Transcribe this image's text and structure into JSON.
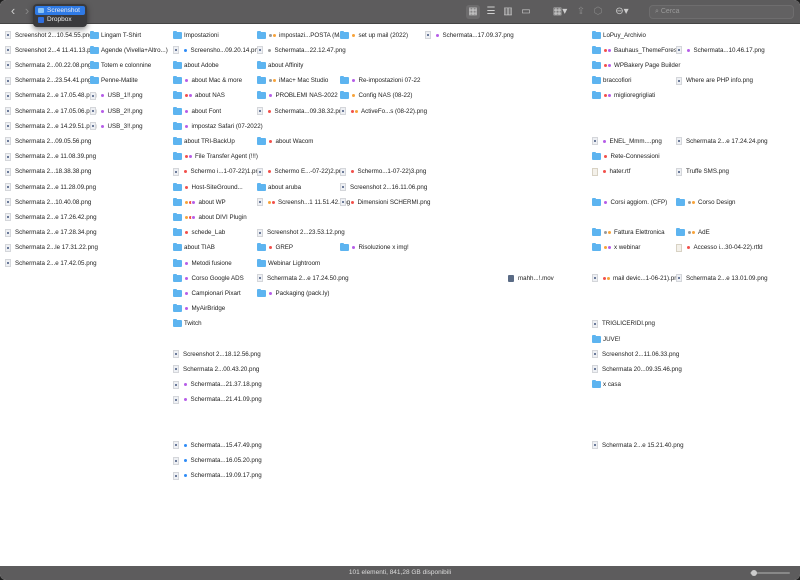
{
  "window": {
    "path_menu": [
      {
        "label": "Screenshot",
        "selected": true
      },
      {
        "label": "Dropbox",
        "selected": false
      }
    ]
  },
  "toolbar": {
    "back": "‹",
    "forward": "›",
    "view_icons": "▦",
    "view_list": "☰",
    "view_columns": "▥",
    "view_gallery": "▭",
    "group": "▦▾",
    "share": "⇪",
    "tag": "⬡",
    "action": "⊖▾",
    "search_placeholder": "Cerca",
    "search_icon": "⌕"
  },
  "tag_colors": {
    "p": "#b65de8",
    "r": "#f2504b",
    "o": "#f8a33a",
    "b": "#2f8cf7",
    "g": "#9a9a9a"
  },
  "columns": [
    [
      [
        "png",
        "",
        "Screenshot 2...10.54.55.png"
      ],
      [
        "png",
        "",
        "Screenshot 2...4 11.41.13.png"
      ],
      [
        "png",
        "",
        "Schermata 2...00.22.08.png"
      ],
      [
        "png",
        "",
        "Schermata 2...23.54.41.png"
      ],
      [
        "png",
        "",
        "Schermata 2...e 17.05.48.png"
      ],
      [
        "png",
        "",
        "Schermata 2...e 17.05.06.png"
      ],
      [
        "png",
        "",
        "Schermata 2...e 14.29.51.png"
      ],
      [
        "png",
        "",
        "Schermata 2...09.05.56.png"
      ],
      [
        "png",
        "",
        "Schermata 2...e 11.08.39.png"
      ],
      [
        "png",
        "",
        "Schermata 2...18.38.38.png"
      ],
      [
        "png",
        "",
        "Schermata 2...e 11.28.09.png"
      ],
      [
        "png",
        "",
        "Schermata 2...10.40.08.png"
      ],
      [
        "png",
        "",
        "Schermata 2...e 17.26.42.png"
      ],
      [
        "png",
        "",
        "Schermata 2...e 17.28.34.png"
      ],
      [
        "png",
        "",
        "Schermata 2...le 17.31.22.png"
      ],
      [
        "png",
        "",
        "Schermata 2...e 17.42.05.png"
      ]
    ],
    [
      [
        "folder",
        "",
        "Lingam T-Shirt"
      ],
      [
        "folder",
        "",
        "Agende (Vivella+Altro...)"
      ],
      [
        "folder",
        "",
        "Totem e colonnine"
      ],
      [
        "folder",
        "",
        "Penne-Matite"
      ],
      [
        "png",
        "p",
        "USB_1!!.png"
      ],
      [
        "png",
        "p",
        "USB_2!!.png"
      ],
      [
        "png",
        "p",
        "USB_3!!.png"
      ]
    ],
    [
      [
        "folder",
        "",
        "Impostazioni"
      ],
      [
        "png",
        "b",
        "Screensho...09.20.14.png"
      ],
      [
        "folder",
        "",
        "about Adobe"
      ],
      [
        "folder",
        "p",
        "about Mac & more"
      ],
      [
        "folder",
        "rp",
        "about NAS"
      ],
      [
        "folder",
        "p",
        "about Font"
      ],
      [
        "folder",
        "p",
        "impostaz Safari (07-2022)"
      ],
      [
        "folder",
        "",
        "about TRI-BackUp"
      ],
      [
        "folder",
        "rp",
        "File Transfer Agent (!!!)"
      ],
      [
        "png",
        "r",
        "Schermo i...1-07-22)1.png"
      ],
      [
        "folder",
        "r",
        "Host-SiteGround..."
      ],
      [
        "folder",
        "orp",
        "about WP"
      ],
      [
        "folder",
        "orp",
        "about DIVI Plugin"
      ],
      [
        "folder",
        "r",
        "schede_Lab"
      ],
      [
        "folder",
        "",
        "about TIAB"
      ],
      [
        "folder",
        "p",
        "Metodi fusione"
      ],
      [
        "folder",
        "p",
        "Corso Google ADS"
      ],
      [
        "folder",
        "p",
        "Campionari Pixart"
      ],
      [
        "folder",
        "p",
        "MyAirBridge"
      ],
      [
        "folder",
        "",
        "Twitch"
      ],
      null,
      [
        "png",
        "",
        "Screenshot 2...18.12.56.png"
      ],
      [
        "png",
        "",
        "Schermata 2...00.43.20.png"
      ],
      [
        "png",
        "p",
        "Schermata...21.37.18.png"
      ],
      [
        "png",
        "p",
        "Schermata...21.41.09.png"
      ],
      null,
      null,
      [
        "png",
        "b",
        "Schermata...15.47.49.png"
      ],
      [
        "png",
        "b",
        "Schermata...16.05.20.png"
      ],
      [
        "png",
        "b",
        "Schermata...19.09.17.png"
      ]
    ],
    [
      [
        "folder",
        "go",
        "impostazi...POSTA (Mail)"
      ],
      [
        "png",
        "g",
        "Schermata...22.12.47.png"
      ],
      [
        "folder",
        "",
        "about Affinity"
      ],
      [
        "folder",
        "go",
        "iMac+ Mac Studio"
      ],
      [
        "folder",
        "p",
        "PROBLEMI NAS-2022"
      ],
      [
        "png",
        "r",
        "Schermata...09.38.32.png"
      ],
      null,
      [
        "folder",
        "r",
        "about Wacom"
      ],
      null,
      [
        "png",
        "r",
        "Schermo E...-07-22)2.png"
      ],
      [
        "folder",
        "",
        "about aruba"
      ],
      [
        "png",
        "or",
        "Screensh...1 11.51.42.png"
      ],
      null,
      [
        "png",
        "",
        "Screenshot 2...23.53.12.png"
      ],
      [
        "folder",
        "r",
        "GREP"
      ],
      [
        "folder",
        "",
        "Webinar Lightroom"
      ],
      [
        "png",
        "",
        "Schermata 2...e 17.24.50.png"
      ],
      [
        "folder",
        "p",
        "Packaging (pack.ly)"
      ]
    ],
    [
      [
        "folder",
        "o",
        "set up mail (2022)"
      ],
      null,
      null,
      [
        "folder",
        "p",
        "Re-impostazioni 07-22"
      ],
      [
        "folder",
        "o",
        "Config NAS (08-22)"
      ],
      [
        "png",
        "ro",
        "ActiveFo...s (08-22).png"
      ],
      null,
      null,
      null,
      [
        "png",
        "r",
        "Schermo...1-07-22)3.png"
      ],
      [
        "png",
        "",
        "Screenshot 2...16.11.06.png"
      ],
      [
        "png",
        "r",
        "Dimensioni SCHERMI.png"
      ],
      null,
      null,
      [
        "folder",
        "p",
        "Risoluzione x img!"
      ]
    ],
    [
      [
        "png",
        "p",
        "Schermata...17.09.37.png"
      ]
    ],
    [
      null,
      null,
      null,
      null,
      null,
      null,
      null,
      null,
      null,
      null,
      null,
      null,
      null,
      null,
      null,
      null,
      [
        "mov",
        "",
        "mahh...!.mov"
      ]
    ],
    [
      [
        "folder",
        "",
        "LoPuy_Archivio"
      ],
      [
        "folder",
        "rp",
        "Bauhaus_ThemeForest"
      ],
      [
        "folder",
        "rp",
        "WPBakery Page Builder"
      ],
      [
        "folder",
        "",
        "braccofiori"
      ],
      [
        "folder",
        "rp",
        "miglioregrigliati"
      ],
      null,
      null,
      [
        "png",
        "p",
        "ENEL_Mmm....png"
      ],
      [
        "folder",
        "r",
        "Rete-Connessioni"
      ],
      [
        "rtf",
        "r",
        "hater.rtf"
      ],
      null,
      [
        "folder",
        "p",
        "Corsi aggiorn. (CFP)"
      ],
      null,
      [
        "folder",
        "go",
        "Fattura Elettronica"
      ],
      [
        "folder",
        "op",
        "x webinar"
      ],
      null,
      [
        "png",
        "ro",
        "mail devic...1-06-21).png"
      ],
      null,
      null,
      [
        "png",
        "",
        "TRIGLICERIDI.png"
      ],
      [
        "folder",
        "",
        "JUVE!"
      ],
      [
        "png",
        "",
        "Screenshot 2...11.06.33.png"
      ],
      [
        "png",
        "",
        "Schermata 20...09.35.46.png"
      ],
      [
        "folder",
        "",
        "x casa"
      ],
      null,
      null,
      null,
      [
        "png",
        "",
        "Schermata 2...e 15.21.40.png"
      ]
    ],
    [
      null,
      [
        "png",
        "p",
        "Schermata...10.46.17.png"
      ],
      null,
      [
        "png",
        "",
        "Where are PHP info.png"
      ],
      null,
      null,
      null,
      [
        "png",
        "",
        "Schermata 2...e 17.24.24.png"
      ],
      null,
      [
        "png",
        "",
        "Truffe SMS.png"
      ],
      null,
      [
        "folder",
        "go",
        "Corso Design"
      ],
      null,
      [
        "folder",
        "go",
        "AdE"
      ],
      [
        "rtf",
        "r",
        "Accesso i...30-04-22).rtfd"
      ],
      null,
      [
        "png",
        "",
        "Schermata 2...e 13.01.09.png"
      ]
    ]
  ],
  "status": {
    "text": "101 elementi, 841,28 GB disponibili"
  },
  "icon_size_slider": 0.1
}
